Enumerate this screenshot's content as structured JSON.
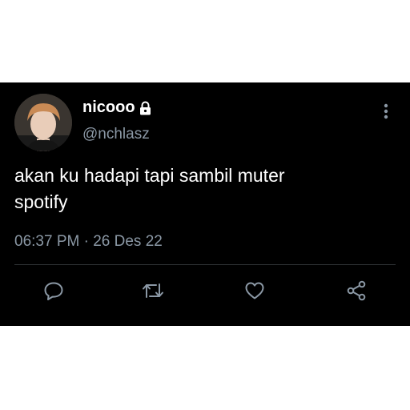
{
  "tweet": {
    "display_name": "nicooo",
    "handle": "@nchlasz",
    "text": "akan ku hadapi tapi sambil muter\nspotify",
    "time": "06:37 PM",
    "separator": "·",
    "date": "26 Des 22",
    "protected": true
  },
  "icons": {
    "lock": "lock-icon",
    "more": "more-vertical-icon",
    "reply": "reply-icon",
    "retweet": "retweet-icon",
    "like": "heart-icon",
    "share": "share-icon"
  },
  "colors": {
    "background": "#000000",
    "text_primary": "#ffffff",
    "text_secondary": "#8b98a5",
    "divider": "#2f3336",
    "icon": "#8b98a5"
  }
}
